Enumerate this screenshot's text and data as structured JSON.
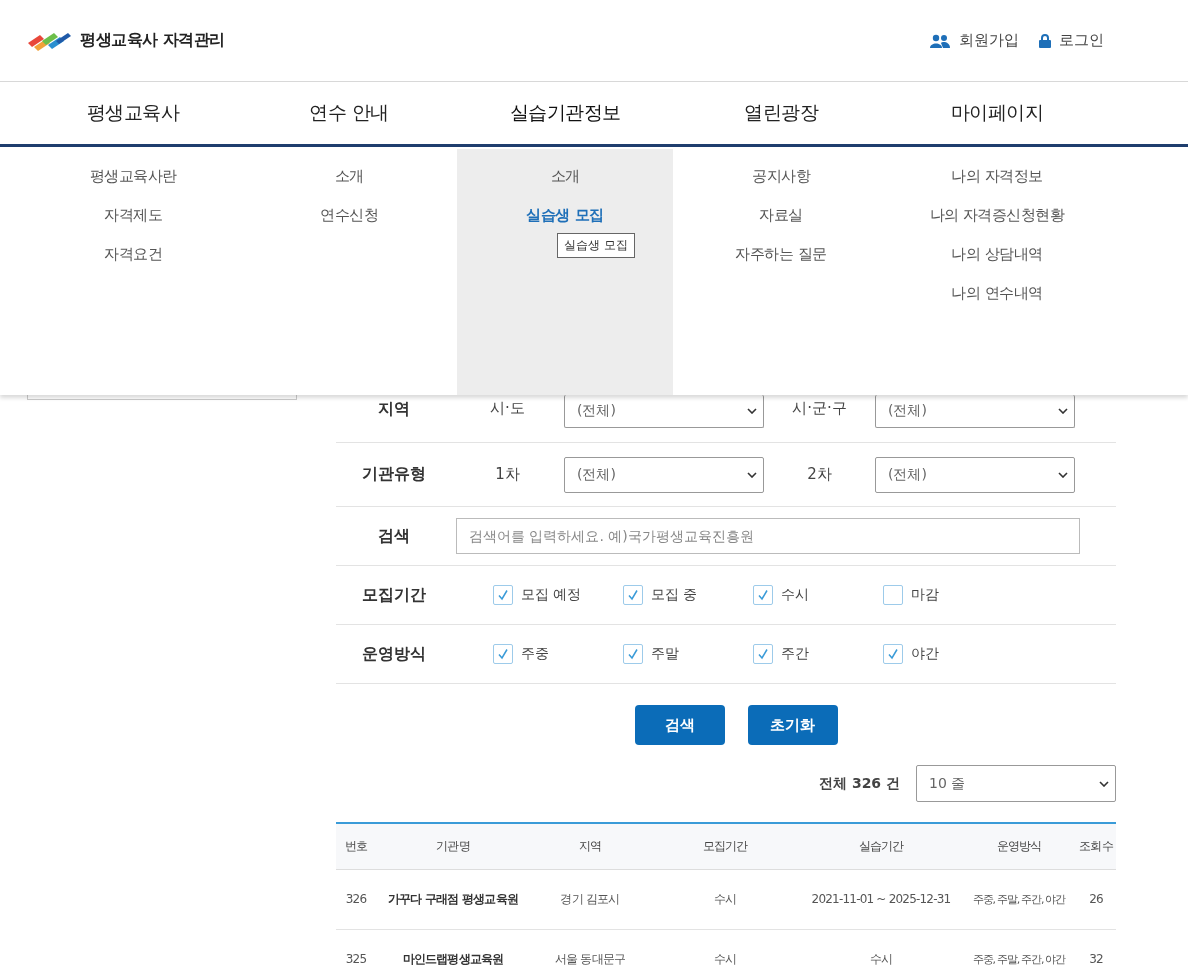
{
  "header": {
    "logo_text": "평생교육사 자격관리",
    "links": [
      {
        "label": "회원가입"
      },
      {
        "label": "로그인"
      }
    ]
  },
  "nav": [
    {
      "label": "평생교육사",
      "selected": false,
      "items": [
        {
          "label": "평생교육사란",
          "selected": false
        },
        {
          "label": "자격제도",
          "selected": false
        },
        {
          "label": "자격요건",
          "selected": false
        }
      ]
    },
    {
      "label": "연수 안내",
      "selected": false,
      "items": [
        {
          "label": "소개",
          "selected": false
        },
        {
          "label": "연수신청",
          "selected": false
        }
      ]
    },
    {
      "label": "실습기관정보",
      "selected": true,
      "items": [
        {
          "label": "소개",
          "selected": false
        },
        {
          "label": "실습생 모집",
          "selected": true
        }
      ]
    },
    {
      "label": "열린광장",
      "selected": false,
      "items": [
        {
          "label": "공지사항",
          "selected": false
        },
        {
          "label": "자료실",
          "selected": false
        },
        {
          "label": "자주하는 질문",
          "selected": false
        }
      ]
    },
    {
      "label": "마이페이지",
      "selected": false,
      "items": [
        {
          "label": "나의 자격정보",
          "selected": false
        },
        {
          "label": "나의 자격증신청현황",
          "selected": false
        },
        {
          "label": "나의 상담내역",
          "selected": false
        },
        {
          "label": "나의 연수내역",
          "selected": false
        }
      ]
    }
  ],
  "tooltip": "실습생 모집",
  "filters": [
    {
      "label": "지역",
      "kind": "selects",
      "fields": [
        {
          "label": "시·도",
          "value": "(전체)"
        },
        {
          "label": "시·군·구",
          "value": "(전체)"
        }
      ]
    },
    {
      "label": "기관유형",
      "kind": "selects",
      "fields": [
        {
          "label": "1차",
          "value": "(전체)"
        },
        {
          "label": "2차",
          "value": "(전체)"
        }
      ]
    },
    {
      "label": "검색",
      "kind": "search",
      "placeholder": "검색어를 입력하세요. 예)국가평생교육진흥원"
    },
    {
      "label": "모집기간",
      "kind": "checks",
      "options": [
        {
          "label": "모집 예정",
          "checked": true
        },
        {
          "label": "모집 중",
          "checked": true
        },
        {
          "label": "수시",
          "checked": true
        },
        {
          "label": "마감",
          "checked": false
        }
      ]
    },
    {
      "label": "운영방식",
      "kind": "checks",
      "options": [
        {
          "label": "주중",
          "checked": true
        },
        {
          "label": "주말",
          "checked": true
        },
        {
          "label": "주간",
          "checked": true
        },
        {
          "label": "야간",
          "checked": true
        }
      ]
    }
  ],
  "actions": [
    "검색",
    "초기화"
  ],
  "summary": "전체 326 건",
  "per_page": "10 줄",
  "table": {
    "columns": [
      "번호",
      "기관명",
      "지역",
      "모집기간",
      "실습기간",
      "운영방식",
      "조회수"
    ],
    "rows": [
      [
        "326",
        "가꾸다 구래점 평생교육원",
        "경기 김포시",
        "수시",
        "2021-11-01 ~ 2025-12-31",
        "주중, 주말, 주간, 야간",
        "26"
      ],
      [
        "325",
        "마인드랩평생교육원",
        "서울 동대문구",
        "수시",
        "수시",
        "주중, 주말, 주간, 야간",
        "32"
      ]
    ]
  }
}
